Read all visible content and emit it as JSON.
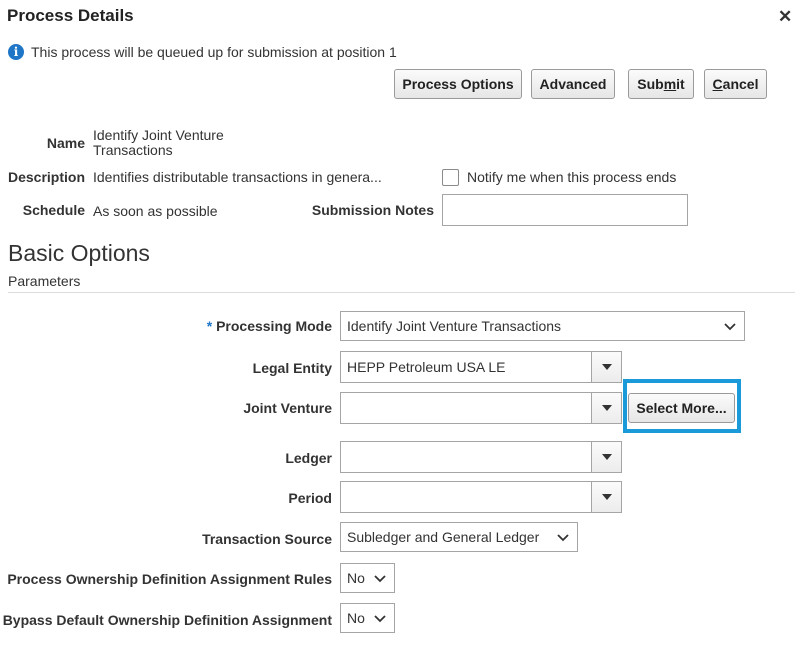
{
  "dialog": {
    "title": "Process Details",
    "close": "✕"
  },
  "info": {
    "icon": "info-icon",
    "text": "This process will be queued up for submission at position 1"
  },
  "buttons": {
    "process_options": "Process Options",
    "advanced": "Advanced",
    "submit_pre": "Sub",
    "submit_key": "m",
    "submit_post": "it",
    "cancel_key": "C",
    "cancel_post": "ancel"
  },
  "details": {
    "name_label": "Name",
    "name_line1": "Identify Joint Venture",
    "name_line2": "Transactions",
    "description_label": "Description",
    "description_value": "Identifies distributable transactions in genera...",
    "notify_label": "Notify me when this process ends",
    "schedule_label": "Schedule",
    "schedule_value": "As soon as possible",
    "submission_notes_label": "Submission Notes",
    "submission_notes_value": ""
  },
  "section": {
    "title": "Basic Options",
    "subtitle": "Parameters"
  },
  "params": {
    "required_marker": "*",
    "processing_mode_label": "Processing Mode",
    "processing_mode_value": "Identify Joint Venture Transactions",
    "legal_entity_label": "Legal Entity",
    "legal_entity_value": "HEPP Petroleum USA LE",
    "joint_venture_label": "Joint Venture",
    "joint_venture_value": "",
    "select_more": "Select More...",
    "ledger_label": "Ledger",
    "ledger_value": "",
    "period_label": "Period",
    "period_value": "",
    "transaction_source_label": "Transaction Source",
    "transaction_source_value": "Subledger and General Ledger",
    "ownership_rules_label": "Process Ownership Definition Assignment Rules",
    "ownership_rules_value": "No",
    "bypass_label": "Bypass Default Ownership Definition Assignment",
    "bypass_value": "No"
  },
  "colors": {
    "highlight": "#1a9ad9",
    "info": "#1f76c7"
  }
}
